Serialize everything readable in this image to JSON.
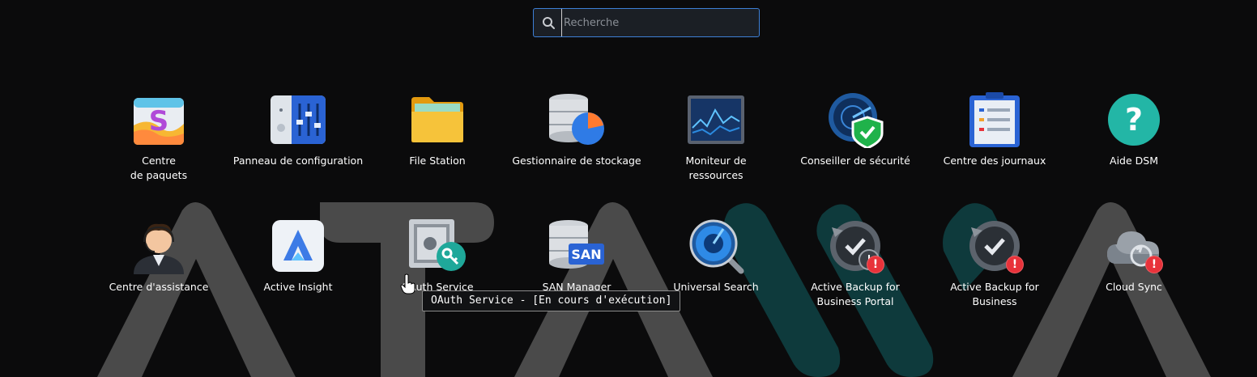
{
  "search": {
    "placeholder": "Recherche"
  },
  "apps_row1": [
    {
      "label": "Centre\nde paquets",
      "icon": "package-center-icon"
    },
    {
      "label": "Panneau de configuration",
      "icon": "control-panel-icon"
    },
    {
      "label": "File Station",
      "icon": "folder-icon"
    },
    {
      "label": "Gestionnaire de stockage",
      "icon": "storage-manager-icon"
    },
    {
      "label": "Moniteur de\nressources",
      "icon": "resource-monitor-icon"
    },
    {
      "label": "Conseiller de sécurité",
      "icon": "security-shield-icon"
    },
    {
      "label": "Centre des journaux",
      "icon": "log-center-icon"
    },
    {
      "label": "Aide DSM",
      "icon": "help-icon"
    }
  ],
  "apps_row2": [
    {
      "label": "Centre d'assistance",
      "icon": "support-agent-icon"
    },
    {
      "label": "Active Insight",
      "icon": "active-insight-icon"
    },
    {
      "label": "OAuth Service",
      "icon": "oauth-safe-icon"
    },
    {
      "label": "SAN Manager",
      "icon": "san-manager-icon",
      "badge_text": "SAN"
    },
    {
      "label": "Universal Search",
      "icon": "magnifier-icon"
    },
    {
      "label": "Active Backup for\nBusiness Portal",
      "icon": "backup-portal-icon",
      "alert": "!"
    },
    {
      "label": "Active Backup for\nBusiness",
      "icon": "backup-icon",
      "alert": "!"
    },
    {
      "label": "Cloud Sync",
      "icon": "cloud-sync-icon",
      "alert": "!"
    }
  ],
  "tooltip": {
    "text": "OAuth Service - [En cours d'exécution]"
  },
  "colors": {
    "accent": "#3d7fd6",
    "alert": "#e8323a",
    "background": "#0b0b0c"
  }
}
